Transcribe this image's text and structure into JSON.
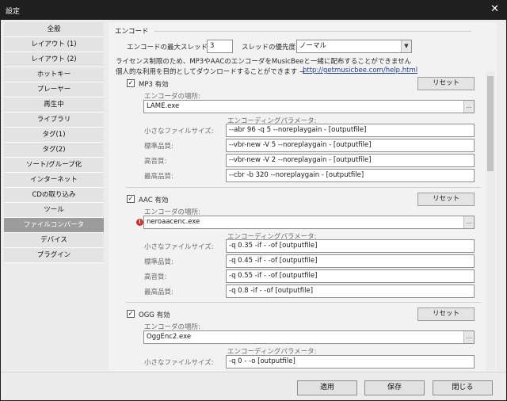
{
  "window": {
    "title": "設定",
    "close_glyph": "✕"
  },
  "sidebar": {
    "items": [
      {
        "label": "全般"
      },
      {
        "label": "レイアウト (1)"
      },
      {
        "label": "レイアウト (2)"
      },
      {
        "label": "ホットキー"
      },
      {
        "label": "プレーヤー"
      },
      {
        "label": "再生中"
      },
      {
        "label": "ライブラリ"
      },
      {
        "label": "タグ(1)"
      },
      {
        "label": "タグ(2)"
      },
      {
        "label": "ソート/グループ化"
      },
      {
        "label": "インターネット"
      },
      {
        "label": "CDの取り込み"
      },
      {
        "label": "ツール"
      },
      {
        "label": "ファイルコンバータ"
      },
      {
        "label": "デバイス"
      },
      {
        "label": "プラグイン"
      }
    ],
    "selected": "ファイルコンバータ"
  },
  "encode": {
    "section_title": "エンコード",
    "max_threads_label": "エンコードの最大スレッド数:",
    "max_threads_value": "3",
    "priority_label": "スレッドの優先度:",
    "priority_value": "ノーマル",
    "license_note_line1": "ライセンス制限のため、MP3やAACのエンコーダをMusicBeeと一緒に配布することができません",
    "license_note_line2": "個人的な利用を目的としてダウンロードすることができます →",
    "help_link": "http://getmusicbee.com/help.html"
  },
  "labels": {
    "encoder_location": "エンコーダの場所:",
    "encoding_params": "エンコーディングパラメータ:",
    "small_file": "小さなファイルサイズ:",
    "standard": "標準品質:",
    "high": "高音質:",
    "best": "最高品質:",
    "reset": "リセット",
    "browse": "..."
  },
  "mp3": {
    "enabled_label": "MP3 有効",
    "checked": true,
    "encoder_path": "LAME.exe",
    "small": "--abr 96 -q 5 --noreplaygain - [outputfile]",
    "standard": "--vbr-new -V 5 --noreplaygain - [outputfile]",
    "high": "--vbr-new -V 2 --noreplaygain - [outputfile]",
    "best": "--cbr -b 320 --noreplaygain - [outputfile]"
  },
  "aac": {
    "enabled_label": "AAC 有効",
    "checked": true,
    "encoder_path": "neroaacenc.exe",
    "error_icon": "!",
    "small": "-q 0.35 -if - -of [outputfile]",
    "standard": "-q 0.45 -if - -of [outputfile]",
    "high": "-q 0.55 -if - -of [outputfile]",
    "best": "-q 0.8 -if - -of [outputfile]"
  },
  "ogg": {
    "enabled_label": "OGG 有効",
    "checked": true,
    "encoder_path": "OggEnc2.exe",
    "small": "-q 0 - -o [outputfile]"
  },
  "footer": {
    "apply": "適用",
    "save": "保存",
    "close": "閉じる"
  },
  "check_glyph": "✓"
}
